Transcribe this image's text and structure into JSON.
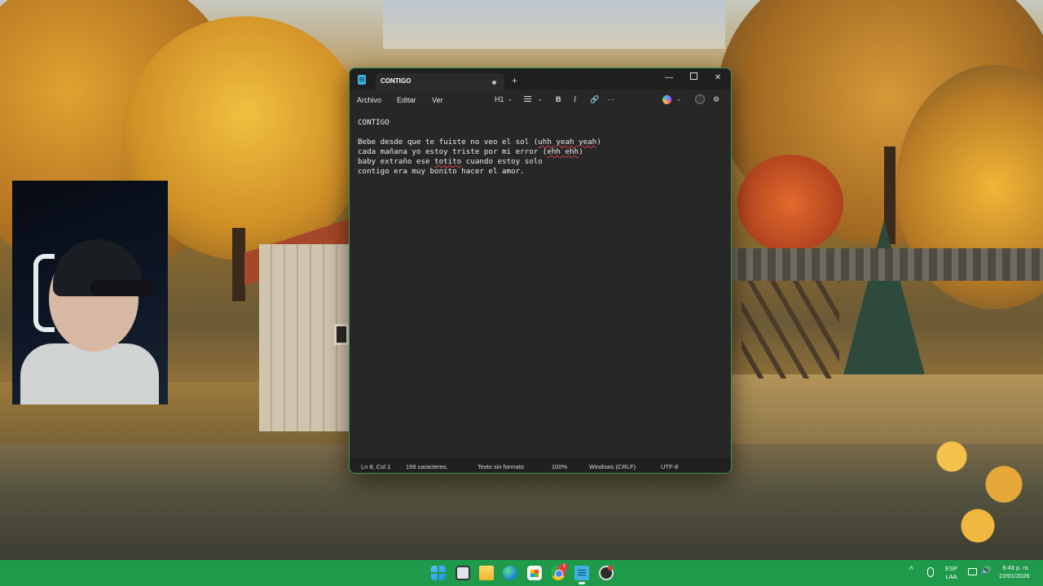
{
  "notepad": {
    "tab_title": "CONTIGO",
    "new_tab_label": "+",
    "window_controls": {
      "minimize": "—",
      "close": "✕"
    },
    "menu": {
      "archivo": "Archivo",
      "editar": "Editar",
      "ver": "Ver"
    },
    "toolbar": {
      "heading": "H1",
      "bold": "B",
      "italic": "I",
      "link": "🔗",
      "more": "···",
      "settings": "⚙",
      "chevron": "⌄"
    },
    "content": {
      "title_line": "CONTIGO",
      "lines": [
        {
          "before": "Bebe desde que te fuiste no veo el sol (",
          "marked": "uhh yeah yeah",
          "after": ")"
        },
        {
          "before": "cada mañana yo estoy triste por mi error (",
          "marked": "ehh ehh",
          "after": ")"
        },
        {
          "before": "baby extraño ese ",
          "marked": "totito",
          "after": " cuando estoy solo"
        },
        {
          "before": "contigo era muy bonito hacer el amor.",
          "marked": "",
          "after": ""
        }
      ]
    },
    "status": {
      "position": "Ln 8, Col 1",
      "characters": "199 caracteres.",
      "format": "Texto sin formato",
      "zoom": "100%",
      "line_ending": "Windows (CRLF)",
      "encoding": "UTF-8"
    }
  },
  "taskbar": {
    "icons": [
      "start-icon",
      "task-view-icon",
      "file-explorer-icon",
      "edge-icon",
      "store-icon",
      "chrome-icon",
      "notepad-icon",
      "obs-icon"
    ],
    "chrome_badge": "1",
    "tray": {
      "chevron": "^",
      "language_top": "ESP",
      "language_bottom": "LAA",
      "volume": "🔊",
      "time": "9:43 p. m.",
      "date": "22/01/2026"
    }
  },
  "colors": {
    "window_bg": "#272727",
    "window_border": "#3f9a52",
    "taskbar": "#1f9a4a",
    "spell_underline": "#d0404a"
  }
}
